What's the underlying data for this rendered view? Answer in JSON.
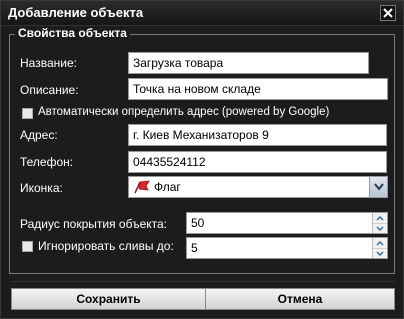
{
  "dialog": {
    "title": "Добавление объекта",
    "close_icon": "close-icon"
  },
  "group": {
    "legend": "Свойства объекта"
  },
  "fields": {
    "name_label": "Название:",
    "name_value": "Загрузка товара",
    "desc_label": "Описание:",
    "desc_value": "Точка на новом складе",
    "auto_address_label": "Автоматически определить адрес (powered by Google)",
    "auto_address_checked": false,
    "address_label": "Адрес:",
    "address_value": "г. Киев Механизаторов 9",
    "phone_label": "Телефон:",
    "phone_value": "04435524112",
    "icon_label": "Иконка:",
    "icon_value": "Флаг",
    "icon_name": "flag-icon",
    "radius_label": "Радиус покрытия объекта:",
    "radius_value": "50",
    "ignore_label": "Игнорировать сливы до:",
    "ignore_checked": false,
    "ignore_value": "5"
  },
  "buttons": {
    "save_label": "Сохранить",
    "cancel_label": "Отмена"
  },
  "colors": {
    "background": "#1c1c1c",
    "flag": "#d9262b"
  }
}
